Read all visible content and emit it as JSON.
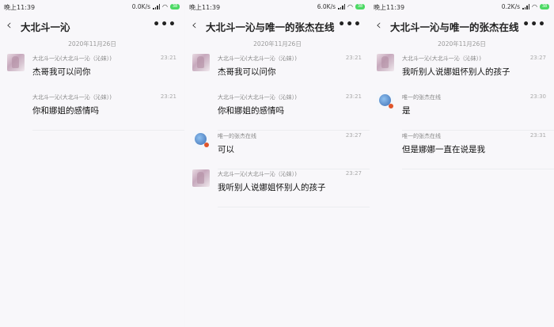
{
  "panels": [
    {
      "status": {
        "time": "晚上11:39",
        "net": "0.0K/s",
        "battery": "38"
      },
      "title": "大北斗一沁",
      "date": "2020年11月26日",
      "messages": [
        {
          "avatar": "girl",
          "sender": "大北斗一沁(大北斗一沁（沁妹）)",
          "time": "23:21",
          "text": "杰哥我可以问你"
        },
        {
          "avatar": "none",
          "sender": "大北斗一沁(大北斗一沁（沁妹）)",
          "time": "23:21",
          "text": "你和娜姐的感情吗"
        }
      ]
    },
    {
      "status": {
        "time": "晚上11:39",
        "net": "6.0K/s",
        "battery": "38"
      },
      "title": "大北斗一沁与唯一的张杰在线",
      "date": "2020年11月26日",
      "messages": [
        {
          "avatar": "girl",
          "sender": "大北斗一沁(大北斗一沁（沁妹）)",
          "time": "23:21",
          "text": "杰哥我可以问你"
        },
        {
          "avatar": "none",
          "sender": "大北斗一沁(大北斗一沁（沁妹）)",
          "time": "23:21",
          "text": "你和娜姐的感情吗"
        },
        {
          "avatar": "boy",
          "sender": "唯一的张杰在线",
          "time": "23:27",
          "text": "可以"
        },
        {
          "avatar": "girl",
          "sender": "大北斗一沁(大北斗一沁（沁妹）)",
          "time": "23:27",
          "text": "我听别人说娜姐怀别人的孩子"
        }
      ]
    },
    {
      "status": {
        "time": "晚上11:39",
        "net": "0.2K/s",
        "battery": "38"
      },
      "title": "大北斗一沁与唯一的张杰在线",
      "date": "2020年11月26日",
      "messages": [
        {
          "avatar": "girl",
          "sender": "大北斗一沁(大北斗一沁（沁妹）)",
          "time": "23:27",
          "text": "我听别人说娜姐怀别人的孩子"
        },
        {
          "avatar": "boy",
          "sender": "唯一的张杰在线",
          "time": "23:30",
          "text": "是"
        },
        {
          "avatar": "none",
          "sender": "唯一的张杰在线",
          "time": "23:31",
          "text": "但是娜娜一直在说是我"
        }
      ]
    }
  ]
}
